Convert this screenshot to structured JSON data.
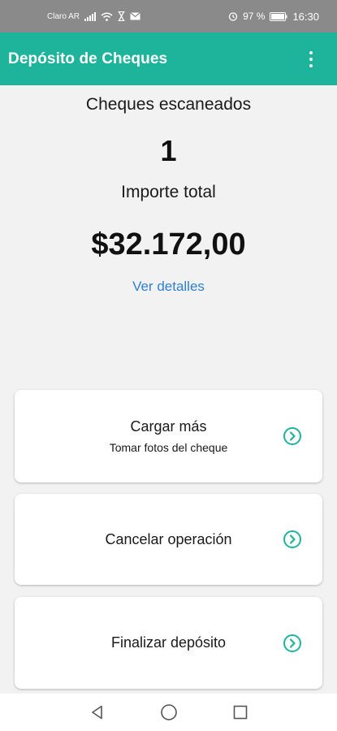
{
  "status_bar": {
    "carrier": "Claro AR",
    "battery": "97 %",
    "clock": "16:30",
    "icons": [
      "signal-icon",
      "wifi-icon",
      "hourglass-icon",
      "mail-icon",
      "alarm-icon",
      "battery-icon"
    ]
  },
  "app_bar": {
    "title": "Depósito de Cheques",
    "menu_icon": "overflow-menu-icon"
  },
  "summary": {
    "scanned_label": "Cheques escaneados",
    "scanned_count": "1",
    "total_label": "Importe total",
    "total_amount": "$32.172,00",
    "details_link": "Ver detalles"
  },
  "actions": [
    {
      "title": "Cargar más",
      "subtitle": "Tomar fotos del cheque",
      "icon": "chevron-right-circle-icon"
    },
    {
      "title": "Cancelar operación",
      "subtitle": "",
      "icon": "chevron-right-circle-icon"
    },
    {
      "title": "Finalizar depósito",
      "subtitle": "",
      "icon": "chevron-right-circle-icon"
    }
  ],
  "nav_bar": {
    "buttons": [
      "back-icon",
      "home-icon",
      "recents-icon"
    ]
  },
  "colors": {
    "accent": "#1db49b",
    "link": "#2f7fd6",
    "background": "#f2f2f2",
    "status_bar": "#8a8a8a"
  }
}
